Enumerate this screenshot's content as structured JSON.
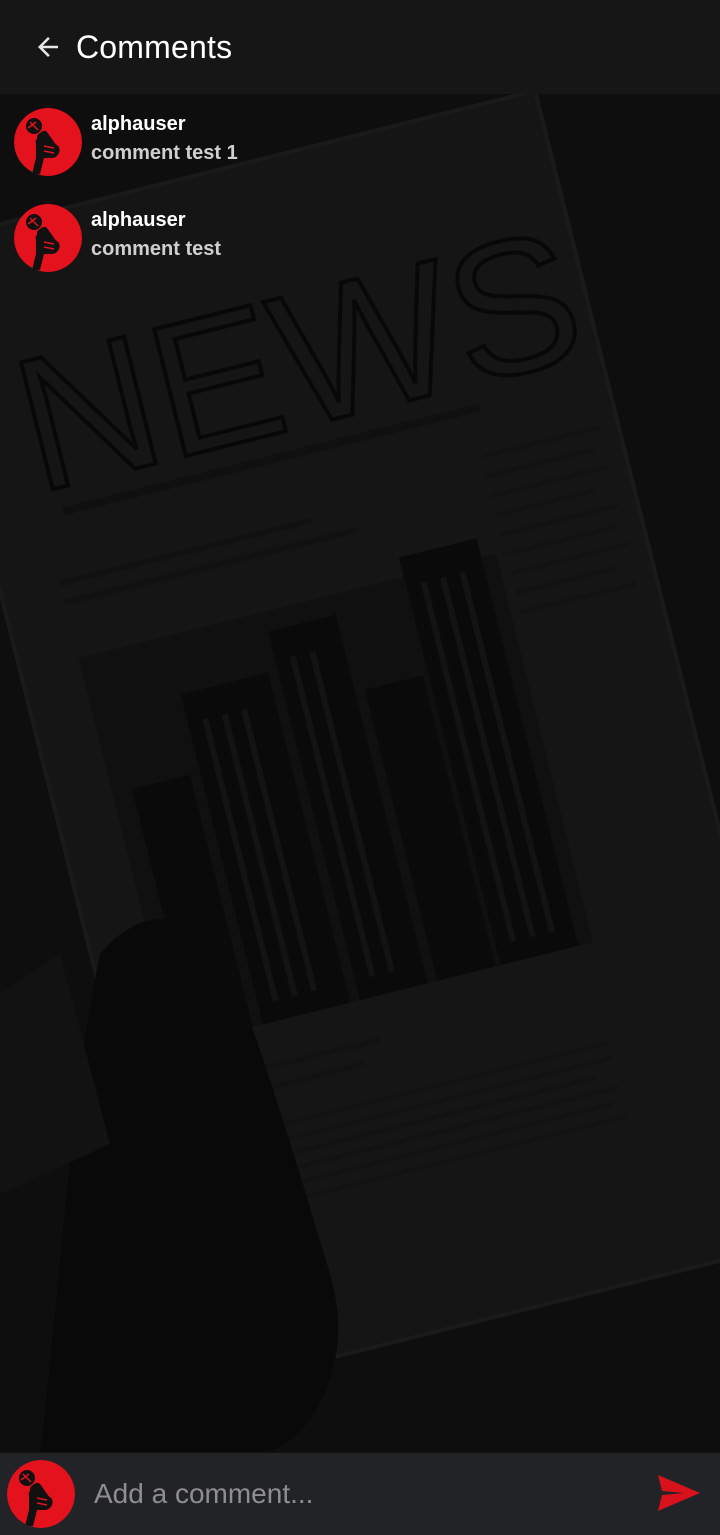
{
  "header": {
    "title": "Comments",
    "back_icon": "arrow-left-icon"
  },
  "comments": [
    {
      "user": "alphauser",
      "text": "comment test 1",
      "avatar_icon": "fist-microphone-icon"
    },
    {
      "user": "alphauser",
      "text": "comment test",
      "avatar_icon": "fist-microphone-icon"
    }
  ],
  "composer": {
    "placeholder": "Add a comment...",
    "send_icon": "send-icon",
    "avatar_icon": "fist-microphone-icon"
  },
  "background": {
    "headline": "NEWS"
  },
  "colors": {
    "accent": "#e3121c",
    "appbar": "#161616",
    "composer": "#222326"
  }
}
